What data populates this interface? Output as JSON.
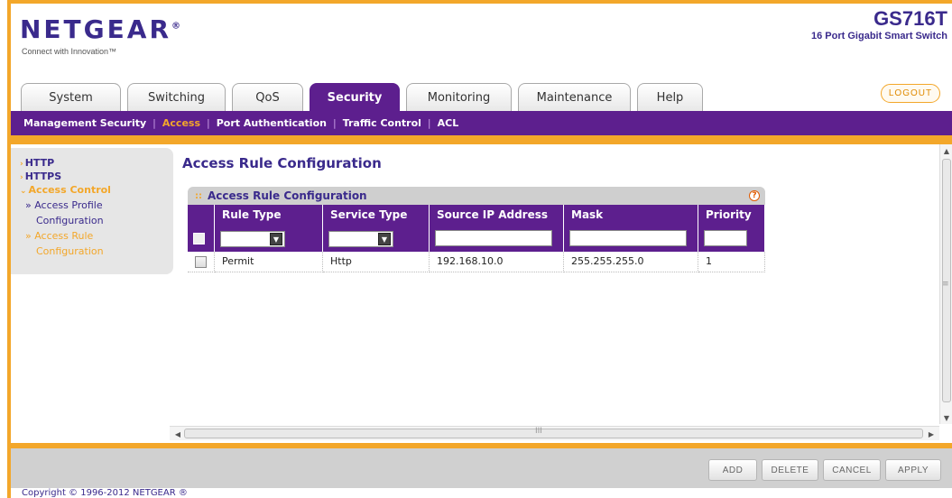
{
  "brand": {
    "logo": "NETGEAR",
    "tagline": "Connect with Innovation™",
    "model": "GS716T",
    "model_desc": "16 Port Gigabit Smart Switch"
  },
  "tabs": [
    {
      "label": "System"
    },
    {
      "label": "Switching"
    },
    {
      "label": "QoS"
    },
    {
      "label": "Security",
      "active": true
    },
    {
      "label": "Monitoring"
    },
    {
      "label": "Maintenance"
    },
    {
      "label": "Help"
    }
  ],
  "logout_label": "LOGOUT",
  "subnav": [
    {
      "label": "Management Security"
    },
    {
      "label": "Access",
      "active": true
    },
    {
      "label": "Port Authentication"
    },
    {
      "label": "Traffic Control"
    },
    {
      "label": "ACL"
    }
  ],
  "leftmenu": {
    "http": "HTTP",
    "https": "HTTPS",
    "access_control": "Access Control",
    "access_profile_1": "» Access Profile",
    "access_profile_2": "Configuration",
    "access_rule_1": "» Access Rule",
    "access_rule_2": "Configuration"
  },
  "page_title": "Access Rule Configuration",
  "panel": {
    "title": "Access Rule Configuration",
    "help": "?",
    "columns": [
      "Rule Type",
      "Service Type",
      "Source IP Address",
      "Mask",
      "Priority"
    ],
    "rows": [
      {
        "rule_type": "Permit",
        "service_type": "Http",
        "source_ip": "192.168.10.0",
        "mask": "255.255.255.0",
        "priority": "1"
      }
    ]
  },
  "buttons": {
    "add": "ADD",
    "delete": "DELETE",
    "cancel": "CANCEL",
    "apply": "APPLY"
  },
  "copyright": "Copyright © 1996-2012 NETGEAR ®",
  "colors": {
    "brand_purple": "#5d1f8e",
    "accent_orange": "#f3a72a",
    "logo_blue": "#3a2a8c"
  }
}
